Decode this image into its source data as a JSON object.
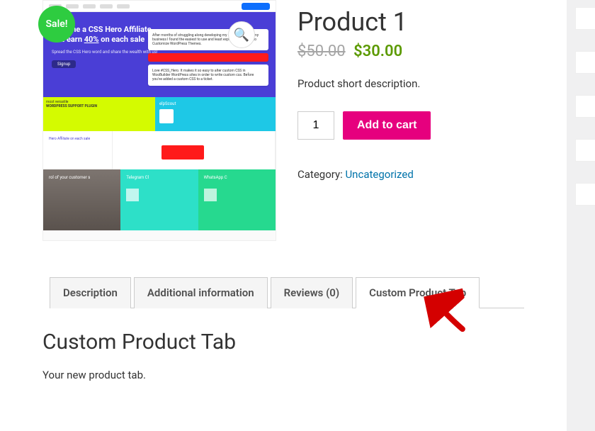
{
  "product": {
    "title": "Product 1",
    "sale_badge": "Sale!",
    "old_price": "$50.00",
    "new_price": "$30.00",
    "short_description": "Product short description.",
    "qty": "1",
    "add_to_cart": "Add to cart",
    "category_label": "Category:",
    "category": "Uncategorized"
  },
  "image_mock": {
    "hero_line1": "Become a CSS Hero Affiliate",
    "hero_line2_pre": "and earn ",
    "hero_line2_em": "40%",
    "hero_line2_post": " on each sale",
    "hero_sub": "Spread the CSS Hero word and share the wealth with us!",
    "hero_btn": "Signup",
    "wp_label": "most versatile",
    "wp_label2": "WORDPRESS SUPPORT PLUGIN",
    "hs_label": "elpScout",
    "aff_lbl": "Hero Affiliate on each sale",
    "bottom_gr": "rol of your customer s",
    "bottom_tg": "Telegram Cl",
    "bottom_wa": "WhatsApp C"
  },
  "tabs": {
    "description": "Description",
    "additional": "Additional information",
    "reviews": "Reviews (0)",
    "custom": "Custom Product Tab"
  },
  "tab_content": {
    "heading": "Custom Product Tab",
    "body": "Your new product tab."
  },
  "zoom_glyph": "🔍"
}
